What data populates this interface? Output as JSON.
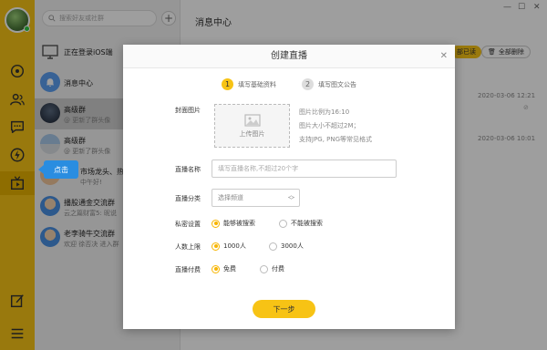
{
  "sidebar": {
    "search_placeholder": "搜索好友或社群",
    "add_icon": "+",
    "items": [
      {
        "name": "正在登录iOS端",
        "sub": ""
      },
      {
        "name": "消息中心",
        "sub": ""
      },
      {
        "name": "高级群",
        "sub": "@ 更新了群头像"
      },
      {
        "name": "高级群",
        "sub": "@ 更新了群头像"
      },
      {
        "name": "市场龙头、热",
        "sub": "中午好!"
      },
      {
        "name": "播股通金交流群",
        "sub": "云之篇财富5: 昵说"
      },
      {
        "name": "老李骑牛交流群",
        "sub": "欢迎 徐否决 进入群"
      }
    ]
  },
  "tooltip": {
    "text": "点击"
  },
  "main": {
    "title": "消息中心",
    "mark_read": "部已读",
    "delete_all": "全部删除",
    "times": [
      "2020-03-06 12:21",
      "2020-03-06 10:01"
    ]
  },
  "modal": {
    "title": "创建直播",
    "close": "✕",
    "steps": [
      {
        "num": "1",
        "label": "填写基础资料"
      },
      {
        "num": "2",
        "label": "填写图文公告"
      }
    ],
    "cover": {
      "label": "封面图片",
      "upload": "上传图片",
      "hints": [
        "图片比例为16:10",
        "图片大小不超过2M；",
        "支持JPG, PNG等常见格式"
      ]
    },
    "live_name": {
      "label": "直播名称",
      "placeholder": "填写直播名称,不超过20个字"
    },
    "live_category": {
      "label": "直播分类",
      "placeholder": "选择频道"
    },
    "privacy": {
      "label": "私密设置",
      "options": [
        "能够被搜索",
        "不能被搜索"
      ]
    },
    "capacity": {
      "label": "人数上限",
      "options": [
        "1000人",
        "3000人"
      ]
    },
    "payment": {
      "label": "直播付费",
      "options": [
        "免费",
        "付费"
      ]
    },
    "next_button": "下一步"
  },
  "colors": {
    "accent": "#f7c315",
    "tooltip": "#2a8de0"
  }
}
